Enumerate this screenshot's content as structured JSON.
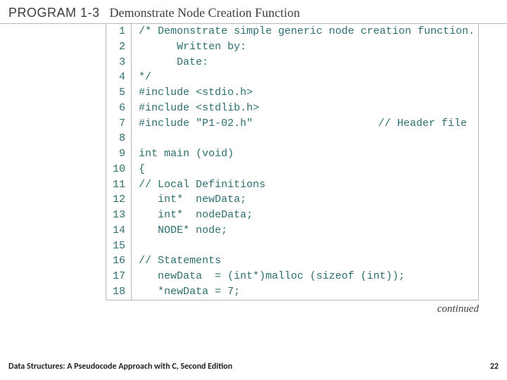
{
  "header": {
    "label": "PROGRAM 1-3",
    "title": "Demonstrate Node Creation Function"
  },
  "code": {
    "lines": [
      {
        "n": "1",
        "t": "/* Demonstrate simple generic node creation function."
      },
      {
        "n": "2",
        "t": "      Written by:"
      },
      {
        "n": "3",
        "t": "      Date:"
      },
      {
        "n": "4",
        "t": "*/"
      },
      {
        "n": "5",
        "t": "#include <stdio.h>"
      },
      {
        "n": "6",
        "t": "#include <stdlib.h>"
      },
      {
        "n": "7",
        "t": "#include \"P1-02.h\"",
        "r": "// Header file"
      },
      {
        "n": "8",
        "t": ""
      },
      {
        "n": "9",
        "t": "int main (void)"
      },
      {
        "n": "10",
        "t": "{"
      },
      {
        "n": "11",
        "t": "// Local Definitions"
      },
      {
        "n": "12",
        "t": "   int*  newData;"
      },
      {
        "n": "13",
        "t": "   int*  nodeData;"
      },
      {
        "n": "14",
        "t": "   NODE* node;"
      },
      {
        "n": "15",
        "t": ""
      },
      {
        "n": "16",
        "t": "// Statements"
      },
      {
        "n": "17",
        "t": "   newData  = (int*)malloc (sizeof (int));"
      },
      {
        "n": "18",
        "t": "   *newData = 7;"
      }
    ]
  },
  "continued": "continued",
  "footer": {
    "left": "Data Structures: A Pseudocode Approach with C, Second Edition",
    "right": "22"
  }
}
